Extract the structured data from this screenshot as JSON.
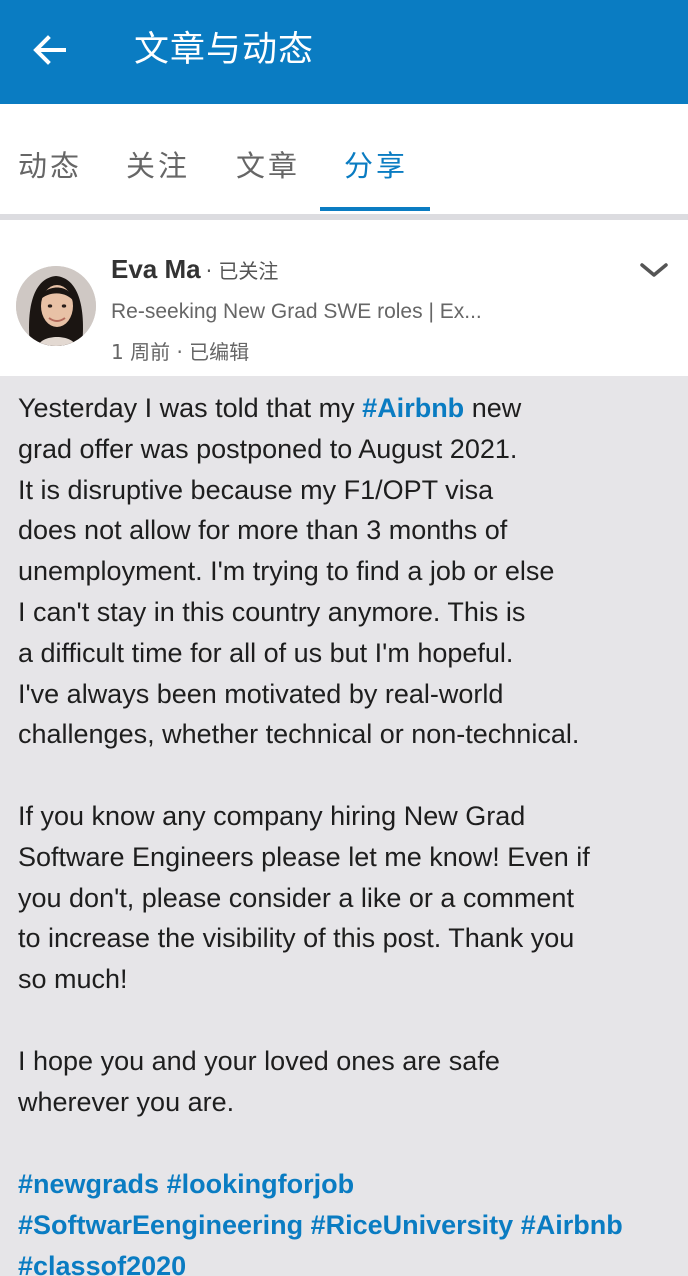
{
  "app_bar": {
    "title": "文章与动态",
    "back_icon": "arrow-left-icon",
    "background_color": "#0a7cc2"
  },
  "tabs": [
    {
      "label": "动态",
      "active": false
    },
    {
      "label": "关注",
      "active": false
    },
    {
      "label": "文章",
      "active": false
    },
    {
      "label": "分享",
      "active": true
    }
  ],
  "post": {
    "author_name": "Eva Ma",
    "follow_status": "· 已关注",
    "headline": "Re-seeking New Grad SWE roles | Ex...",
    "meta": "1 周前 · 已编辑",
    "menu_icon": "chevron-down-icon",
    "paragraphs": [
      {
        "lines": [
          [
            "Yesterday I was told that my ",
            "#Airbnb",
            " new"
          ],
          [
            "grad offer was postponed to August 2021.",
            "",
            ""
          ],
          [
            "It is disruptive because my F1/OPT visa",
            "",
            ""
          ],
          [
            "does not allow for more than 3 months of",
            "",
            ""
          ],
          [
            "unemployment. I'm trying to find a job or else",
            "",
            ""
          ],
          [
            "I can't stay in this country anymore. This is",
            "",
            ""
          ],
          [
            "a difficult time for all of us but I'm hopeful.",
            "",
            ""
          ],
          [
            "I've always been motivated by real-world",
            "",
            ""
          ],
          [
            "challenges, whether technical or non-technical.",
            "",
            ""
          ]
        ]
      },
      {
        "lines": [
          [
            "If you know any company hiring New Grad",
            "",
            ""
          ],
          [
            "Software Engineers please let me know! Even if",
            "",
            ""
          ],
          [
            "you don't, please consider a like or a comment",
            "",
            ""
          ],
          [
            "to increase the visibility of this post. Thank you",
            "",
            ""
          ],
          [
            "so much!",
            "",
            ""
          ]
        ]
      },
      {
        "lines": [
          [
            "I hope you and your loved ones are safe",
            "",
            ""
          ],
          [
            "wherever you are.",
            "",
            ""
          ]
        ]
      }
    ],
    "hashtag_lines": [
      [
        "#newgrads",
        "#lookingforjob"
      ],
      [
        "#SoftwarEengineering",
        "#RiceUniversity",
        "#Airbnb"
      ],
      [
        "#classof2020"
      ]
    ]
  },
  "colors": {
    "accent": "#0a7cc2",
    "body_background": "#e6e5e8"
  }
}
